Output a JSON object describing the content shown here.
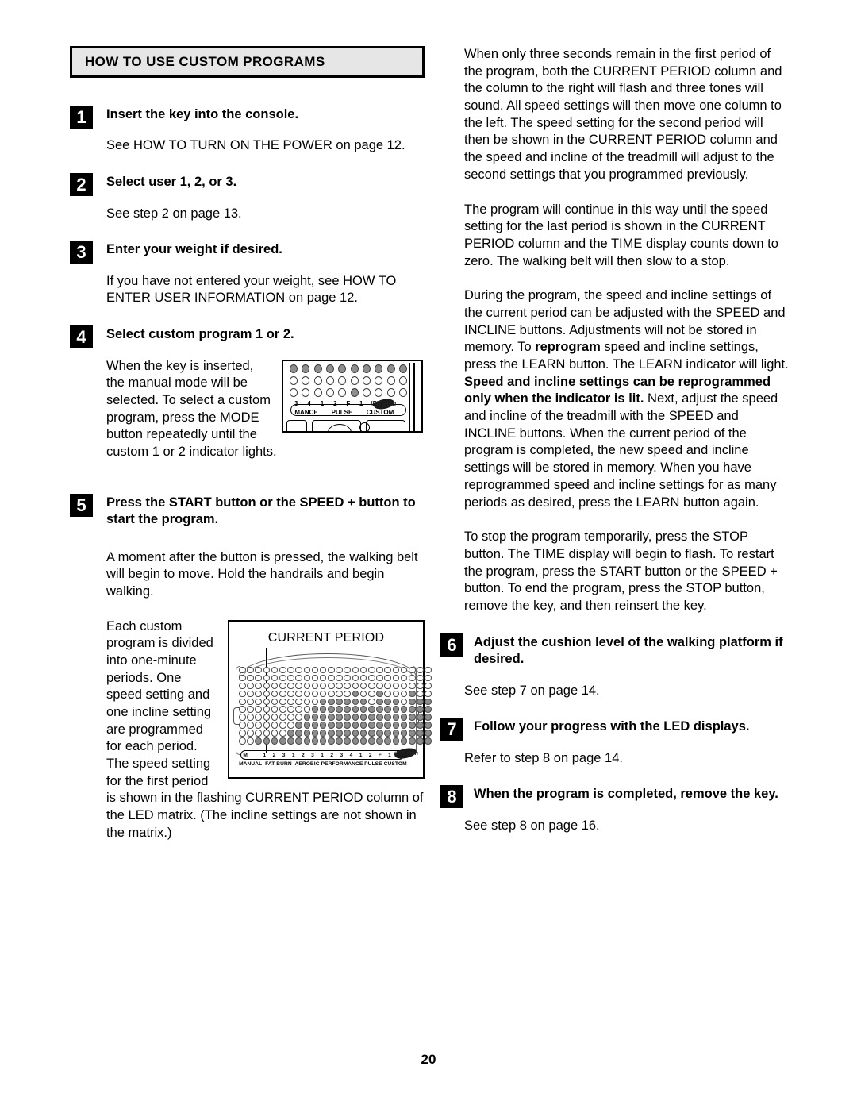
{
  "page": {
    "number": "20",
    "section_title": "HOW TO USE CUSTOM PROGRAMS"
  },
  "left_column": {
    "steps": [
      {
        "num": "1",
        "heading": "Insert the key into the console.",
        "body": "See HOW TO TURN ON THE POWER on page 12."
      },
      {
        "num": "2",
        "heading": "Select user 1, 2, or 3.",
        "body": "See step 2 on page 13."
      },
      {
        "num": "3",
        "heading": "Enter your weight if desired.",
        "body": "If you have not entered your weight, see HOW TO ENTER USER INFORMATION on page 12."
      },
      {
        "num": "4",
        "heading": "Select custom program 1 or 2.",
        "body": "When the key is inserted, the manual mode will be selected. To select a custom program, press the MODE button repeatedly until the custom 1 or 2 indicator lights."
      },
      {
        "num": "5",
        "heading": "Press the START button or the SPEED + button to start the program.",
        "body1": "A moment after the button is pressed, the walking belt will begin to move. Hold the handrails and begin walking.",
        "body2": "Each custom program is divided into one-minute periods. One speed setting and one incline setting are programmed for each period. The speed setting for the first period is shown in the flashing CURRENT PERIOD column of the LED matrix. (The incline settings are not shown in the matrix.)"
      }
    ]
  },
  "right_column": {
    "paragraphs": [
      "When only three seconds remain in the first period of the program, both the CURRENT PERIOD column and the column to the right will flash and three tones will sound. All speed settings will then move one column to the left. The speed setting for the second period will then be shown in the CURRENT PERIOD column and the speed and incline of the treadmill will adjust to the second settings that you programmed previously.",
      "The program will continue in this way until the speed setting for the last period is shown in the CURRENT PERIOD column and the TIME display counts down to zero. The walking belt will then slow to a stop."
    ],
    "reprogram_paragraph": {
      "part1": "During the program, the speed and incline settings of the current period can be adjusted with the SPEED and INCLINE buttons. Adjustments will not be stored in memory. To ",
      "bold1": "reprogram",
      "part2": " speed and incline settings, press the LEARN button. The LEARN indicator will light. ",
      "bold2": "Speed and incline settings can be reprogrammed only when the indicator is lit.",
      "part3": " Next, adjust the speed and incline of the treadmill with the SPEED and INCLINE buttons. When the current period of the program is completed, the new speed and incline settings will be stored in memory. When you have reprogrammed speed and incline settings for as many periods as desired, press the LEARN button again."
    },
    "stop_paragraph": "To stop the program temporarily, press the STOP button. The TIME display will begin to flash. To restart the program, press the START button or the SPEED + button. To end the program, press the STOP button, remove the key, and then reinsert the key.",
    "steps": [
      {
        "num": "6",
        "heading": "Adjust the cushion level of the walking platform if desired.",
        "body": "See step 7 on page 14."
      },
      {
        "num": "7",
        "heading": "Follow your progress with the LED displays.",
        "body": "Refer to step 8 on page 14."
      },
      {
        "num": "8",
        "heading": "When the program is completed, remove the key.",
        "body": "See step 8 on page 16."
      }
    ]
  },
  "console_figure": {
    "brand": "iFIT.com",
    "row_numbers": [
      "3",
      "4",
      "1",
      "2",
      "F",
      "1",
      "2"
    ],
    "category_labels": [
      "MANCE",
      "PULSE",
      "CUSTOM"
    ],
    "leds": [
      [
        1,
        1,
        1,
        1,
        1,
        1,
        1,
        1,
        1,
        1
      ],
      [
        0,
        0,
        0,
        0,
        0,
        0,
        0,
        0,
        0,
        0
      ],
      [
        0,
        0,
        0,
        0,
        0,
        1,
        0,
        0,
        0,
        0
      ]
    ]
  },
  "matrix_figure": {
    "title": "CURRENT PERIOD",
    "brand": "iFIT.com",
    "column_numbers": [
      "M",
      "",
      "1",
      "2",
      "3",
      "1",
      "2",
      "3",
      "1",
      "2",
      "3",
      "4",
      "1",
      "2",
      "F",
      "1",
      "2"
    ],
    "category_labels": [
      "MANUAL",
      "FAT BURN",
      "AEROBIC",
      "PERFORMANCE",
      "PULSE",
      "CUSTOM"
    ],
    "columns": 24,
    "rows": 10,
    "bar_heights": [
      0,
      0,
      1,
      1,
      1,
      1,
      2,
      3,
      4,
      5,
      6,
      6,
      6,
      6,
      7,
      6,
      5,
      7,
      6,
      6,
      5,
      7,
      6,
      6
    ]
  },
  "colors": {
    "header_bg": "#e6e6e6",
    "rule": "#000000",
    "led_on": "#8c8c8c",
    "led_off": "#ffffff"
  }
}
